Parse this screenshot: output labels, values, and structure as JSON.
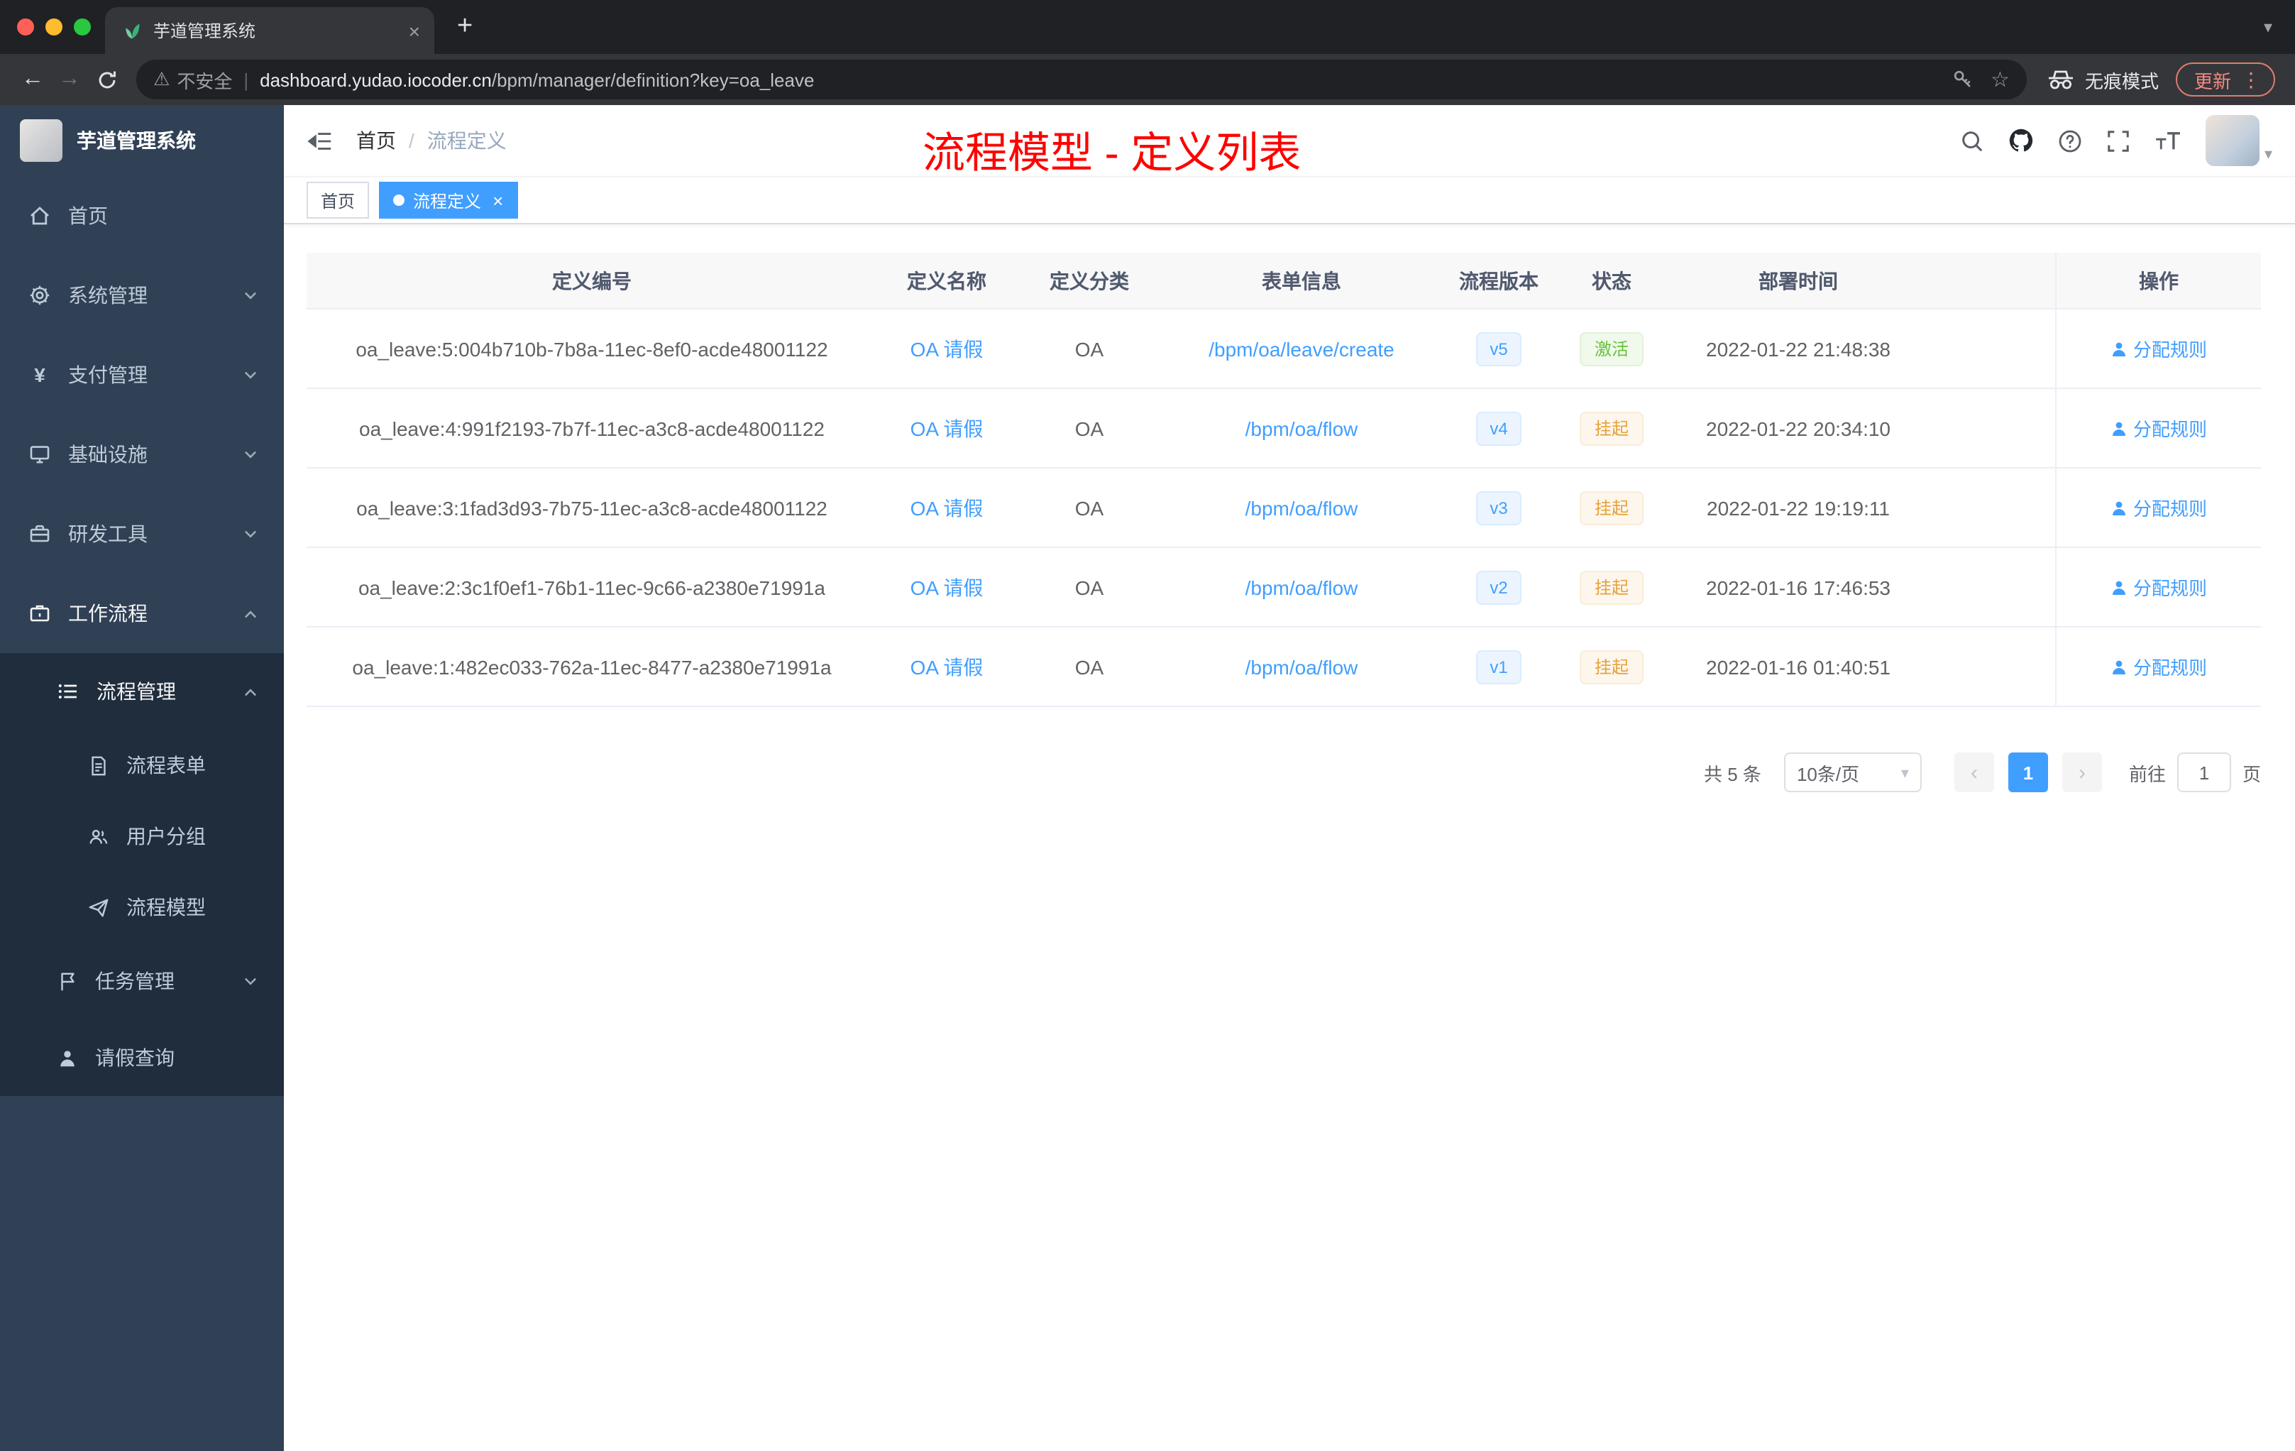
{
  "theme": {
    "accent_blue": "#409eff",
    "success_green": "#67c23a",
    "warning_orange": "#e6a23c",
    "annotation_red": "#ff0000",
    "sidebar_bg": "#304156",
    "submenu_bg": "#1f2d3d"
  },
  "browser": {
    "tab_title": "芋道管理系统",
    "security_label": "不安全",
    "url_host": "dashboard.yudao.iocoder.cn",
    "url_path": "/bpm/manager/definition?key=oa_leave",
    "incognito_label": "无痕模式",
    "update_label": "更新"
  },
  "icons": {
    "close": "×",
    "new_tab": "+",
    "back": "←",
    "forward": "→",
    "star": "☆",
    "warning": "⚠",
    "menu_dots": "⋮",
    "prev": "‹",
    "next": "›",
    "caret_down": "▾",
    "divider": "|",
    "yen": "¥"
  },
  "sidebar": {
    "logo_title": "芋道管理系统",
    "items": [
      {
        "label": "首页"
      },
      {
        "label": "系统管理"
      },
      {
        "label": "支付管理"
      },
      {
        "label": "基础设施"
      },
      {
        "label": "研发工具"
      },
      {
        "label": "工作流程"
      },
      {
        "label": "流程管理"
      },
      {
        "label": "流程表单"
      },
      {
        "label": "用户分组"
      },
      {
        "label": "流程模型"
      },
      {
        "label": "任务管理"
      },
      {
        "label": "请假查询"
      }
    ]
  },
  "header": {
    "breadcrumb_home": "首页",
    "breadcrumb_sep": "/",
    "breadcrumb_current": "流程定义",
    "annotation": "流程模型 - 定义列表"
  },
  "tags": {
    "home": "首页",
    "active": "流程定义"
  },
  "table": {
    "columns": {
      "id": "定义编号",
      "name": "定义名称",
      "category": "定义分类",
      "form": "表单信息",
      "version": "流程版本",
      "status": "状态",
      "deploy_time": "部署时间",
      "actions": "操作"
    },
    "rows": [
      {
        "id": "oa_leave:5:004b710b-7b8a-11ec-8ef0-acde48001122",
        "name": "OA 请假",
        "category": "OA",
        "form": "/bpm/oa/leave/create",
        "version": "v5",
        "status": "激活",
        "status_type": "success",
        "deploy_time": "2022-01-22 21:48:38",
        "action": "分配规则"
      },
      {
        "id": "oa_leave:4:991f2193-7b7f-11ec-a3c8-acde48001122",
        "name": "OA 请假",
        "category": "OA",
        "form": "/bpm/oa/flow",
        "version": "v4",
        "status": "挂起",
        "status_type": "warning",
        "deploy_time": "2022-01-22 20:34:10",
        "action": "分配规则"
      },
      {
        "id": "oa_leave:3:1fad3d93-7b75-11ec-a3c8-acde48001122",
        "name": "OA 请假",
        "category": "OA",
        "form": "/bpm/oa/flow",
        "version": "v3",
        "status": "挂起",
        "status_type": "warning",
        "deploy_time": "2022-01-22 19:19:11",
        "action": "分配规则"
      },
      {
        "id": "oa_leave:2:3c1f0ef1-76b1-11ec-9c66-a2380e71991a",
        "name": "OA 请假",
        "category": "OA",
        "form": "/bpm/oa/flow",
        "version": "v2",
        "status": "挂起",
        "status_type": "warning",
        "deploy_time": "2022-01-16 17:46:53",
        "action": "分配规则"
      },
      {
        "id": "oa_leave:1:482ec033-762a-11ec-8477-a2380e71991a",
        "name": "OA 请假",
        "category": "OA",
        "form": "/bpm/oa/flow",
        "version": "v1",
        "status": "挂起",
        "status_type": "warning",
        "deploy_time": "2022-01-16 01:40:51",
        "action": "分配规则"
      }
    ]
  },
  "pagination": {
    "total": "共 5 条",
    "page_size": "10条/页",
    "current_page": "1",
    "goto_label": "前往",
    "goto_value": "1",
    "page_unit": "页"
  }
}
